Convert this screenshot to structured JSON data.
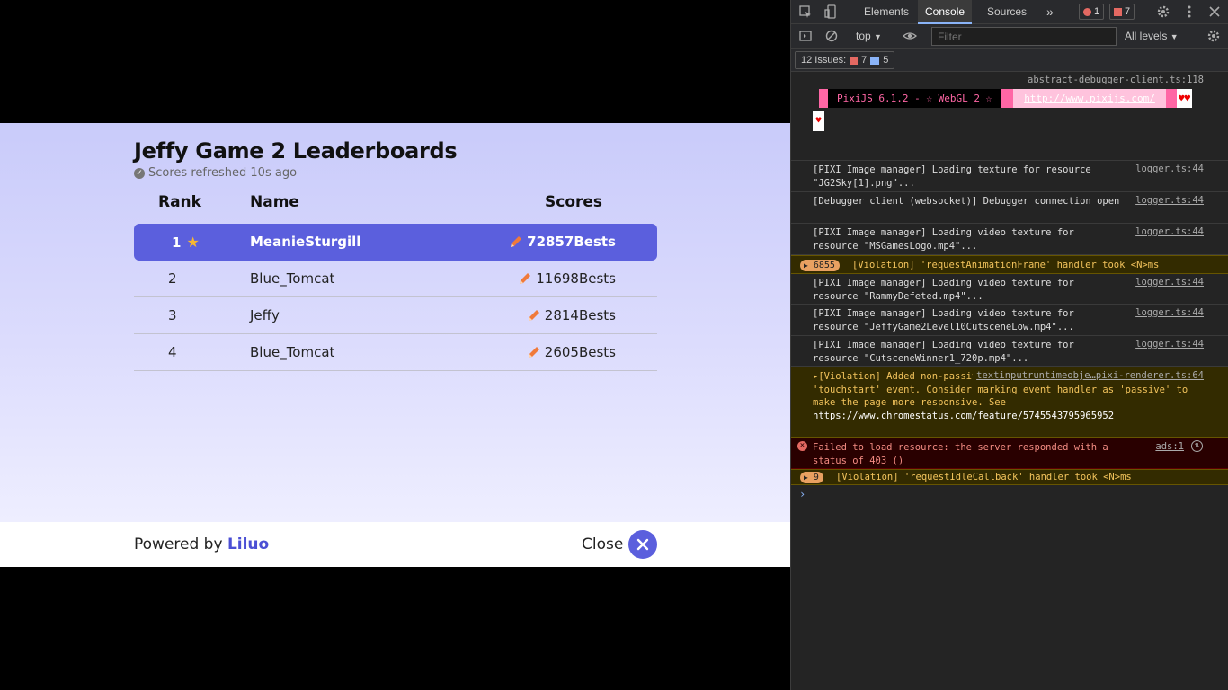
{
  "leaderboard": {
    "title": "Jeffy Game 2 Leaderboards",
    "refresh_text": "Scores refreshed 10s ago",
    "headers": {
      "rank": "Rank",
      "name": "Name",
      "scores": "Scores"
    },
    "rows": [
      {
        "rank": "1",
        "name": "MeanieSturgill",
        "score": "72857Bests"
      },
      {
        "rank": "2",
        "name": "Blue_Tomcat",
        "score": "11698Bests"
      },
      {
        "rank": "3",
        "name": "Jeffy",
        "score": "2814Bests"
      },
      {
        "rank": "4",
        "name": "Blue_Tomcat",
        "score": "2605Bests"
      }
    ],
    "footer": {
      "powered_prefix": "Powered by ",
      "brand": "Liluo",
      "close_label": "Close"
    },
    "colors": {
      "accent": "#5b5fdd",
      "brand": "#4b4fd4",
      "star": "#f7b731",
      "pencil": "#f07a3a"
    }
  },
  "devtools": {
    "tabs": [
      "Elements",
      "Console",
      "Sources"
    ],
    "active_tab": "Console",
    "error_count": "1",
    "issue_count": "7",
    "context": "top",
    "filter_placeholder": "Filter",
    "levels": "All levels",
    "issues_label": "12 Issues:",
    "issues_errors": "7",
    "issues_info": "5",
    "pixi_source": "abstract-debugger-client.ts:118",
    "pixi_banner_text": "PixiJS 6.1.2 - ☆ WebGL 2 ☆",
    "pixi_url": "http://www.pixijs.com/",
    "pixi_hearts": "♥♥",
    "pixi_heart": "♥",
    "messages": [
      {
        "text": "[PIXI Image manager] Loading texture for resource \"JG2Sky[1].png\"...",
        "src": "logger.ts:44"
      },
      {
        "text": "[Debugger client (websocket)] Debugger connection open",
        "src": "logger.ts:44"
      },
      {
        "text": "[PIXI Image manager] Loading video texture for resource \"MSGamesLogo.mp4\"...",
        "src": "logger.ts:44"
      },
      {
        "text": "[Violation] 'requestAnimationFrame' handler took <N>ms",
        "count": "6855"
      },
      {
        "text": "[PIXI Image manager] Loading video texture for resource \"RammyDefeted.mp4\"...",
        "src": "logger.ts:44"
      },
      {
        "text": "[PIXI Image manager] Loading video texture for resource \"JeffyGame2Level10CutsceneLow.mp4\"...",
        "src": "logger.ts:44"
      },
      {
        "text": "[PIXI Image manager] Loading video texture for resource \"CutsceneWinner1_720p.mp4\"...",
        "src": "logger.ts:44"
      },
      {
        "text": "▸[Violation] Added non-passive event listener to a scroll-blocking 'touchstart' event. Consider marking event handler as 'passive' to make the page more responsive. See ",
        "link": "https://www.chromestatus.com/feature/5745543795965952",
        "src": "textinputruntimeobje…pixi-renderer.ts:64"
      },
      {
        "text": "Failed to load resource: the server responded with a status of 403 ()",
        "src": "ads:1"
      },
      {
        "text": "[Violation] 'requestIdleCallback' handler took <N>ms",
        "count": "9"
      }
    ]
  }
}
